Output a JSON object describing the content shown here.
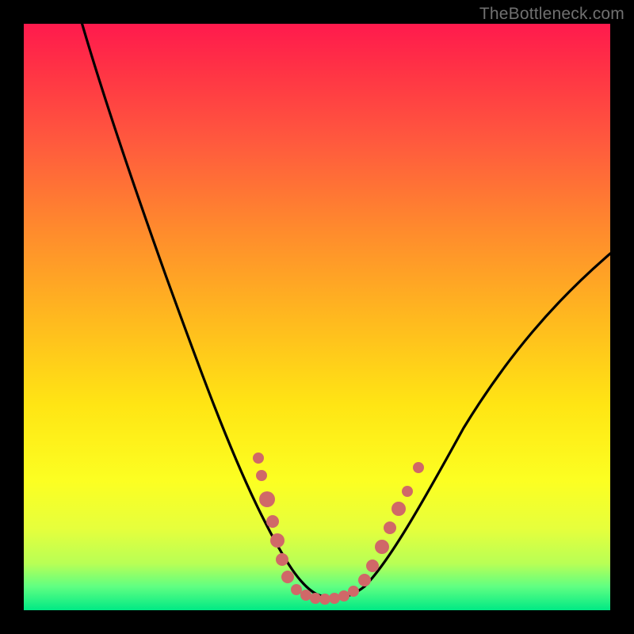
{
  "watermark": "TheBottleneck.com",
  "chart_data": {
    "type": "line",
    "title": "",
    "xlabel": "",
    "ylabel": "",
    "xlim": [
      0,
      100
    ],
    "ylim": [
      0,
      100
    ],
    "series": [
      {
        "name": "bottleneck-curve",
        "x": [
          0,
          5,
          10,
          15,
          20,
          25,
          30,
          35,
          40,
          44,
          47,
          50,
          53,
          56,
          60,
          65,
          70,
          75,
          80,
          85,
          90,
          95,
          100
        ],
        "values": [
          104,
          96,
          86,
          76,
          66,
          56,
          46,
          36,
          24,
          12,
          5,
          2,
          2,
          4,
          9,
          18,
          27,
          35,
          42,
          49,
          55,
          60,
          65
        ]
      }
    ],
    "dot_clusters": [
      {
        "name": "left-cluster",
        "x_range": [
          40,
          47
        ],
        "y_range": [
          5,
          28
        ]
      },
      {
        "name": "right-cluster",
        "x_range": [
          57,
          65
        ],
        "y_range": [
          5,
          22
        ]
      },
      {
        "name": "valley-floor",
        "x_range": [
          45,
          57
        ],
        "y_range": [
          1,
          4
        ]
      }
    ],
    "colors": {
      "curve": "#000000",
      "dots": "#d36a6a",
      "gradient_top": "#ff1a4d",
      "gradient_mid": "#ffe514",
      "gradient_bottom": "#00e985"
    }
  }
}
